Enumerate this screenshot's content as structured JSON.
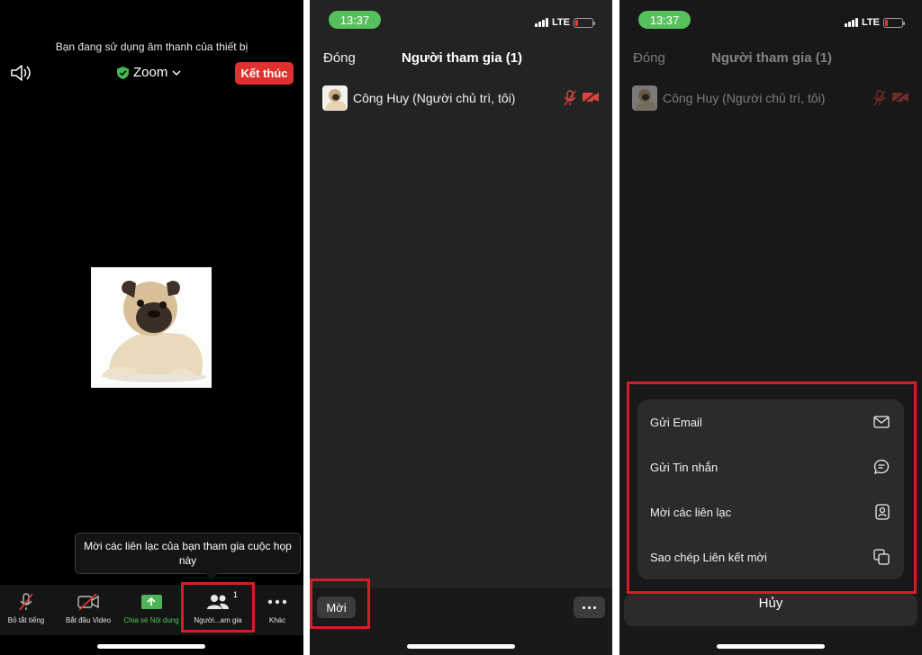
{
  "panel1": {
    "audio_banner": "Bạn đang sử dụng âm thanh của thiết bị",
    "meeting_title": "Zoom",
    "end_button": "Kết thúc",
    "tooltip": "Mời các liên lạc của bạn tham gia cuộc họp này",
    "toolbar": {
      "mute": "Bỏ tắt tiếng",
      "video": "Bắt đầu Video",
      "share": "Chia sẻ Nội dung",
      "participants": "Người...am gia",
      "participants_count": "1",
      "more": "Khác"
    }
  },
  "status_bar": {
    "time": "13:37",
    "network": "LTE"
  },
  "panel2": {
    "close": "Đóng",
    "title": "Người tham gia (1)",
    "participant_name": "Công Huy (Người chủ trì, tôi)",
    "invite_button": "Mời"
  },
  "panel3": {
    "close": "Đóng",
    "title": "Người tham gia (1)",
    "participant_name": "Công Huy (Người chủ trì, tôi)",
    "menu": [
      {
        "label": "Gửi Email",
        "icon": "envelope-icon"
      },
      {
        "label": "Gửi Tin nhắn",
        "icon": "chat-bubble-icon"
      },
      {
        "label": "Mời các liên lạc",
        "icon": "contact-card-icon"
      },
      {
        "label": "Sao chép Liên kết mời",
        "icon": "copy-icon"
      }
    ],
    "cancel": "Hủy"
  },
  "colors": {
    "end_red": "#e0312e",
    "highlight_red": "#d21f26",
    "share_green": "#4fb457",
    "time_green": "#56c05d"
  }
}
